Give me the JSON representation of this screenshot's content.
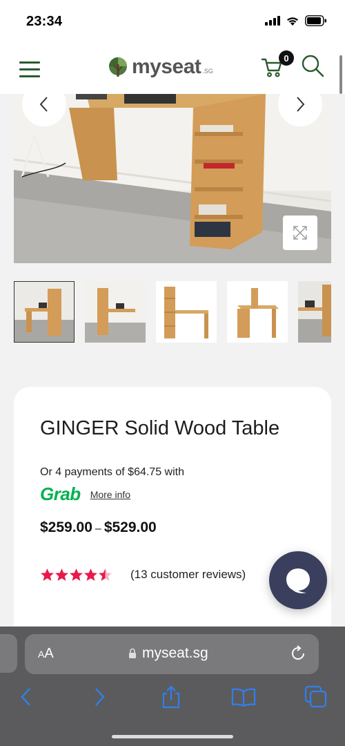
{
  "status_bar": {
    "time": "23:34"
  },
  "header": {
    "logo_text": "myseat",
    "logo_suffix": ".SG",
    "cart_count": "0",
    "brand_color": "#2a5a2e"
  },
  "gallery": {
    "prev_label": "previous-image",
    "next_label": "next-image",
    "thumbnail_count": 5
  },
  "product": {
    "title": "GINGER Solid Wood Table",
    "installments_text": "Or 4 payments of $64.75 with",
    "payment_provider": "Grab",
    "more_info_label": "More info",
    "price_min": "$259.00",
    "price_sep": "–",
    "price_max": "$529.00",
    "rating": 4.5,
    "rating_max": 5,
    "reviews_text": "(13 customer reviews)",
    "star_color": "#e8194a"
  },
  "safari": {
    "aa_label_small": "A",
    "aa_label_big": "A",
    "url": "myseat.sg",
    "accent": "#2f80ed"
  }
}
